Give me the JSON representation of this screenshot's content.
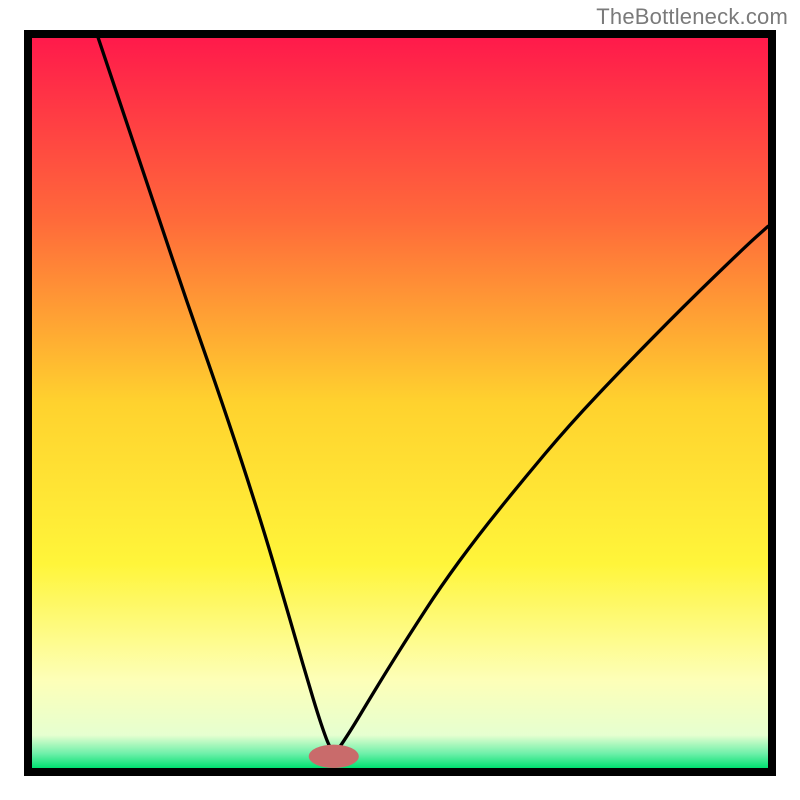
{
  "brand": {
    "watermark": "TheBottleneck.com"
  },
  "chart_data": {
    "type": "line",
    "title": "",
    "xlabel": "",
    "ylabel": "",
    "xlim": [
      0,
      100
    ],
    "ylim": [
      0,
      100
    ],
    "grid": false,
    "background_gradient": {
      "stops": [
        {
          "offset": 0.0,
          "color": "#ff1a4b"
        },
        {
          "offset": 0.25,
          "color": "#ff6a3a"
        },
        {
          "offset": 0.5,
          "color": "#ffd22e"
        },
        {
          "offset": 0.72,
          "color": "#fff53a"
        },
        {
          "offset": 0.88,
          "color": "#fdffb8"
        },
        {
          "offset": 0.955,
          "color": "#e6ffd0"
        },
        {
          "offset": 0.98,
          "color": "#6ff0aa"
        },
        {
          "offset": 1.0,
          "color": "#00e070"
        }
      ]
    },
    "marker": {
      "x": 41,
      "y": 1.6,
      "color": "#c96b6b",
      "rx": 3.4,
      "ry": 1.6
    },
    "series": [
      {
        "name": "left-branch",
        "x": [
          9.0,
          13.0,
          17.0,
          21.0,
          25.0,
          28.5,
          31.5,
          34.0,
          36.0,
          37.6,
          38.8,
          39.7,
          40.3,
          40.9,
          41.0
        ],
        "y": [
          100.0,
          88.0,
          76.0,
          64.0,
          52.5,
          42.0,
          32.5,
          24.0,
          17.0,
          11.5,
          7.5,
          4.8,
          3.2,
          2.2,
          1.8
        ]
      },
      {
        "name": "right-branch",
        "x": [
          41.0,
          41.4,
          42.3,
          43.7,
          45.6,
          48.2,
          51.5,
          55.5,
          60.5,
          66.5,
          73.0,
          80.5,
          88.5,
          97.0,
          100.0
        ],
        "y": [
          1.8,
          2.3,
          3.6,
          5.8,
          9.0,
          13.3,
          18.6,
          24.8,
          31.7,
          39.2,
          47.0,
          55.0,
          63.2,
          71.5,
          74.2
        ]
      }
    ]
  }
}
